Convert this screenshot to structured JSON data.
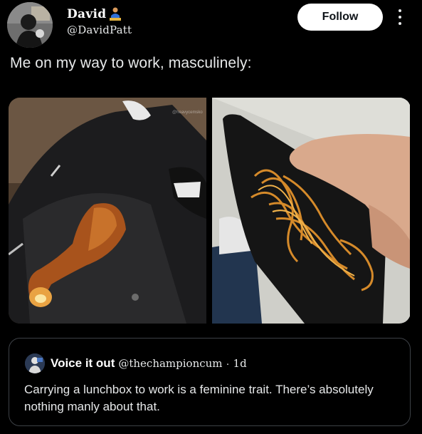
{
  "author": {
    "display_name": "David",
    "name_emoji": "person-emoji",
    "handle": "@DavidPatt"
  },
  "follow_label": "Follow",
  "tweet_text": "Me on my way to work, masculinely:",
  "media": {
    "left_image": "photo of a cooked chicken drumstick stuffed in a jeans pocket",
    "left_watermark": "@heavycemsko",
    "right_image": "photo of a hand holding a wallet filled with spaghetti"
  },
  "quote": {
    "display_name": "Voice it out",
    "handle": "@thechampioncum",
    "separator": "·",
    "time": "1d",
    "text": "Carrying a lunchbox to work is a feminine trait. There’s absolutely nothing manly about that."
  },
  "colors": {
    "background": "#000000",
    "text": "#e7e9ea",
    "follow_bg": "#ffffff",
    "border": "#3d4146"
  }
}
